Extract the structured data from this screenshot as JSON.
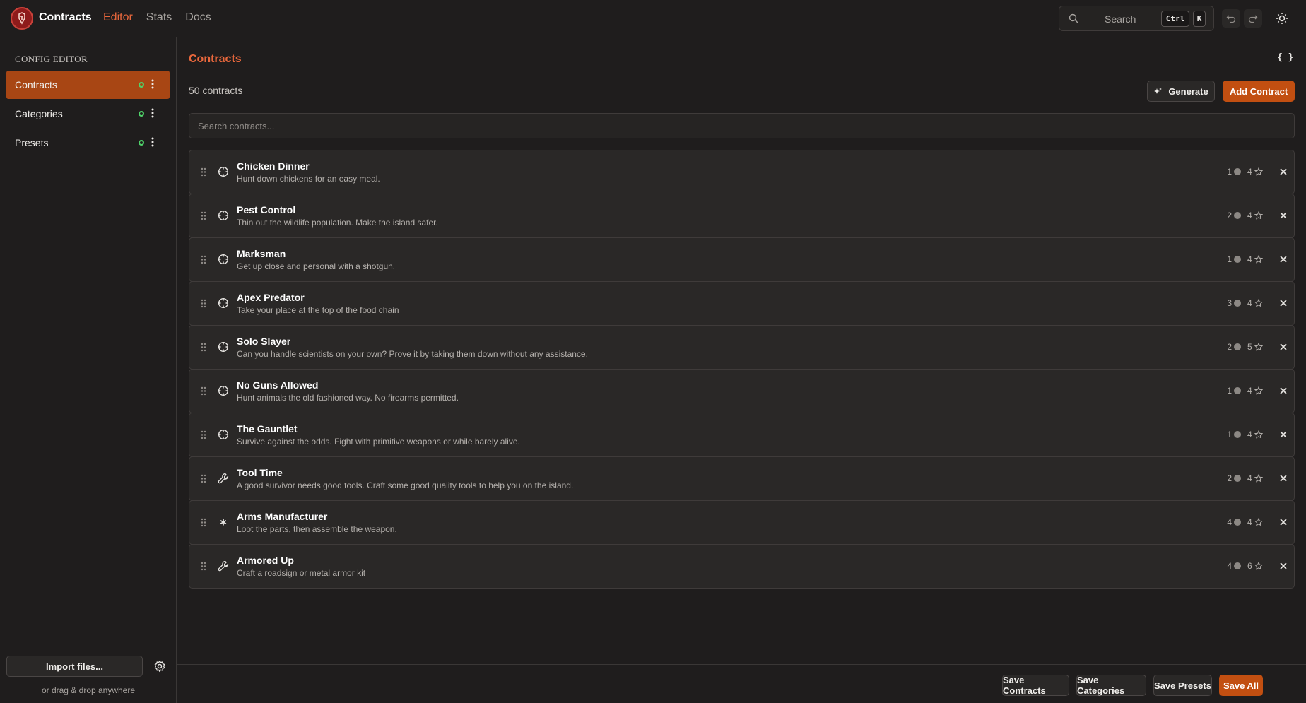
{
  "app": {
    "brand": "Contracts",
    "nav": [
      "Editor",
      "Stats",
      "Docs"
    ],
    "search_label": "Search",
    "shortcut_keys": [
      "Ctrl",
      "K"
    ],
    "accent_color": "#c24f11"
  },
  "sidebar": {
    "heading": "CONFIG EDITOR",
    "items": [
      {
        "label": "Contracts",
        "active": true
      },
      {
        "label": "Categories",
        "active": false
      },
      {
        "label": "Presets",
        "active": false
      }
    ],
    "import_label": "Import files...",
    "drop_hint": "or drag & drop anywhere"
  },
  "main": {
    "title": "Contracts",
    "json_toggle": "{ }",
    "count_text": "50 contracts",
    "generate_label": "Generate",
    "add_label": "Add Contract",
    "search_placeholder": "Search contracts..."
  },
  "contracts": [
    {
      "title": "Chicken Dinner",
      "desc": "Hunt down chickens for an easy meal.",
      "icon": "crosshair-icon",
      "tier": "1",
      "stars": "4"
    },
    {
      "title": "Pest Control",
      "desc": "Thin out the wildlife population. Make the island safer.",
      "icon": "crosshair-icon",
      "tier": "2",
      "stars": "4"
    },
    {
      "title": "Marksman",
      "desc": "Get up close and personal with a shotgun.",
      "icon": "crosshair-icon",
      "tier": "1",
      "stars": "4"
    },
    {
      "title": "Apex Predator",
      "desc": "Take your place at the top of the food chain",
      "icon": "crosshair-icon",
      "tier": "3",
      "stars": "4"
    },
    {
      "title": "Solo Slayer",
      "desc": "Can you handle scientists on your own? Prove it by taking them down without any assistance.",
      "icon": "crosshair-icon",
      "tier": "2",
      "stars": "5"
    },
    {
      "title": "No Guns Allowed",
      "desc": "Hunt animals the old fashioned way. No firearms permitted.",
      "icon": "crosshair-icon",
      "tier": "1",
      "stars": "4"
    },
    {
      "title": "The Gauntlet",
      "desc": "Survive against the odds. Fight with primitive weapons or while barely alive.",
      "icon": "crosshair-icon",
      "tier": "1",
      "stars": "4"
    },
    {
      "title": "Tool Time",
      "desc": "A good survivor needs good tools. Craft some good quality tools to help you on the island.",
      "icon": "wrench-icon",
      "tier": "2",
      "stars": "4"
    },
    {
      "title": "Arms Manufacturer",
      "desc": "Loot the parts, then assemble the weapon.",
      "icon": "asterisk-icon",
      "tier": "4",
      "stars": "4"
    },
    {
      "title": "Armored Up",
      "desc": "Craft a roadsign or metal armor kit",
      "icon": "wrench-icon",
      "tier": "4",
      "stars": "6"
    }
  ],
  "footer": {
    "save_contracts": "Save Contracts",
    "save_categories": "Save Categories",
    "save_presets": "Save Presets",
    "save_all": "Save All"
  }
}
